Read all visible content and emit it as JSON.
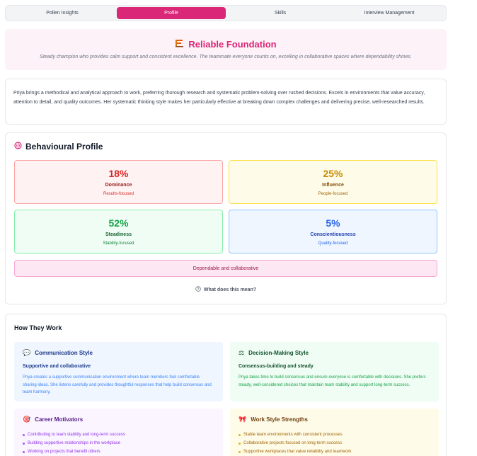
{
  "tabs": [
    {
      "label": "Pollen Insights",
      "active": false
    },
    {
      "label": "Profile",
      "active": true
    },
    {
      "label": "Skills",
      "active": false
    },
    {
      "label": "Interview Management",
      "active": false
    }
  ],
  "hero": {
    "title": "Reliable Foundation",
    "icon": "construction-icon",
    "subtitle": "Steady champion who provides calm support and consistent excellence. The teammate everyone counts on, excelling in collaborative spaces where dependability shines."
  },
  "summary": "Priya brings a methodical and analytical approach to work, preferring thorough research and systematic problem-solving over rushed decisions. Excels in environments that value accuracy, attention to detail, and quality outcomes. Her systematic thinking style makes her particularly effective at breaking down complex challenges and delivering precise, well-researched results.",
  "behavioural": {
    "title": "Behavioural Profile",
    "dimensions": [
      {
        "percent": "18%",
        "name": "Dominance",
        "desc": "Results-focused"
      },
      {
        "percent": "25%",
        "name": "Influence",
        "desc": "People-focused"
      },
      {
        "percent": "52%",
        "name": "Steadiness",
        "desc": "Stability-focused"
      },
      {
        "percent": "5%",
        "name": "Conscientiousness",
        "desc": "Quality-focused"
      }
    ],
    "tag": "Dependable and collaborative",
    "meaning_link": "What does this mean?"
  },
  "how_they_work": {
    "title": "How They Work",
    "communication": {
      "title": "Communication Style",
      "subtitle": "Supportive and collaborative",
      "text": "Priya creates a supportive communication environment where team members feel comfortable sharing ideas. She listens carefully and provides thoughtful responses that help build consensus and team harmony."
    },
    "decision": {
      "title": "Decision-Making Style",
      "subtitle": "Consensus-building and steady",
      "text": "Priya takes time to build consensus and ensure everyone is comfortable with decisions. She prefers steady, well-considered choices that maintain team stability and support long-term success."
    },
    "motivators": {
      "title": "Career Motivators",
      "items": [
        "Contributing to team stability and long-term success",
        "Building supportive relationships in the workplace",
        "Working on projects that benefit others"
      ]
    },
    "strengths": {
      "title": "Work Style Strengths",
      "items": [
        "Stable team environments with consistent processes",
        "Collaborative projects focused on long-term success",
        "Supportive workplaces that value reliability and teamwork"
      ]
    }
  }
}
